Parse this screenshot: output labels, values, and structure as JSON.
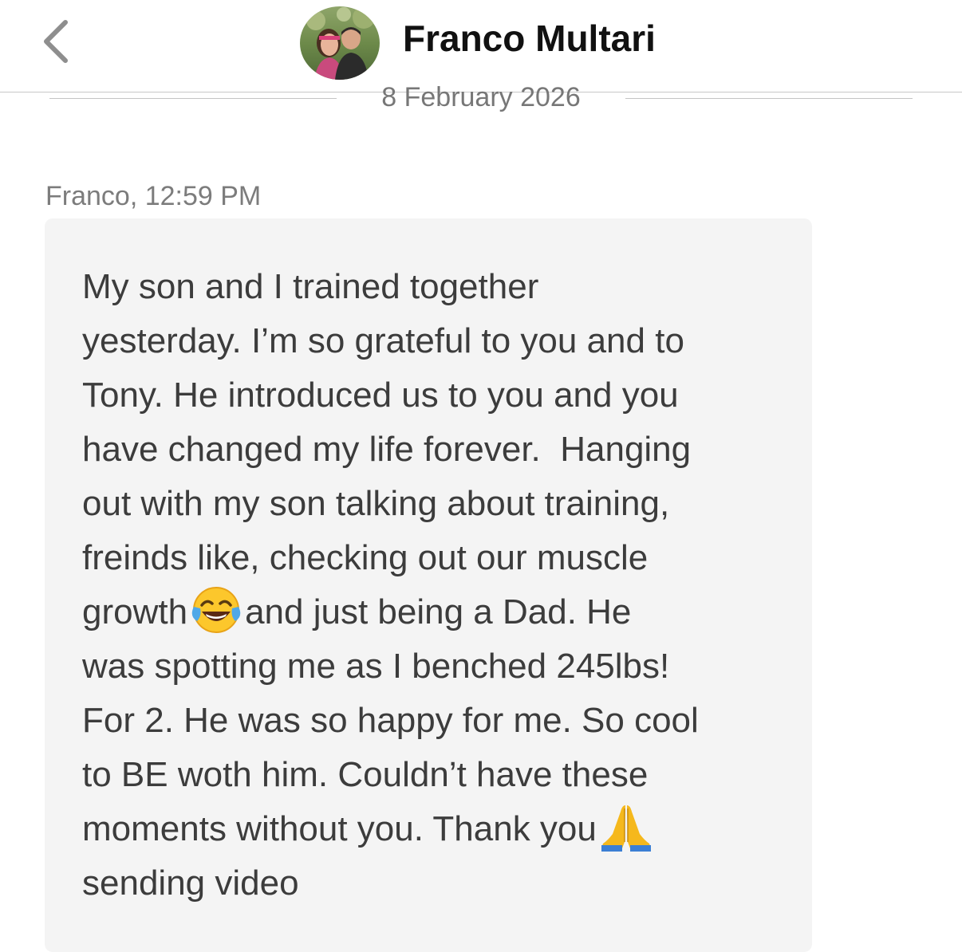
{
  "header": {
    "contact_name": "Franco Multari",
    "avatar_icon": "contact-avatar-photo",
    "back_icon": "chevron-left-icon"
  },
  "date_separator": {
    "text": "8 February 2026"
  },
  "message": {
    "meta": "Franco, 12:59 PM",
    "lines": [
      "My son and I trained together",
      "yesterday. I’m so grateful to you and to",
      "Tony. He introduced us to you and you",
      "have changed my life forever.  Hanging",
      "out with my son talking about training,",
      "freinds like, checking out our muscle",
      "growth",
      "and just being a Dad. He",
      "was spotting me as I benched 245lbs!",
      "For 2. He was so happy for me. So cool",
      "to BE woth him. Couldn’t have these",
      "moments without you. Thank you",
      "sending video"
    ],
    "emojis": {
      "laughing": "face-with-tears-of-joy-icon",
      "praying": "folded-hands-icon"
    }
  },
  "colors": {
    "bubble_bg": "#f4f4f4",
    "meta_text": "#7c7c7c",
    "message_text": "#3c3c3c",
    "header_title": "#111111",
    "divider": "#c4c4c4"
  }
}
